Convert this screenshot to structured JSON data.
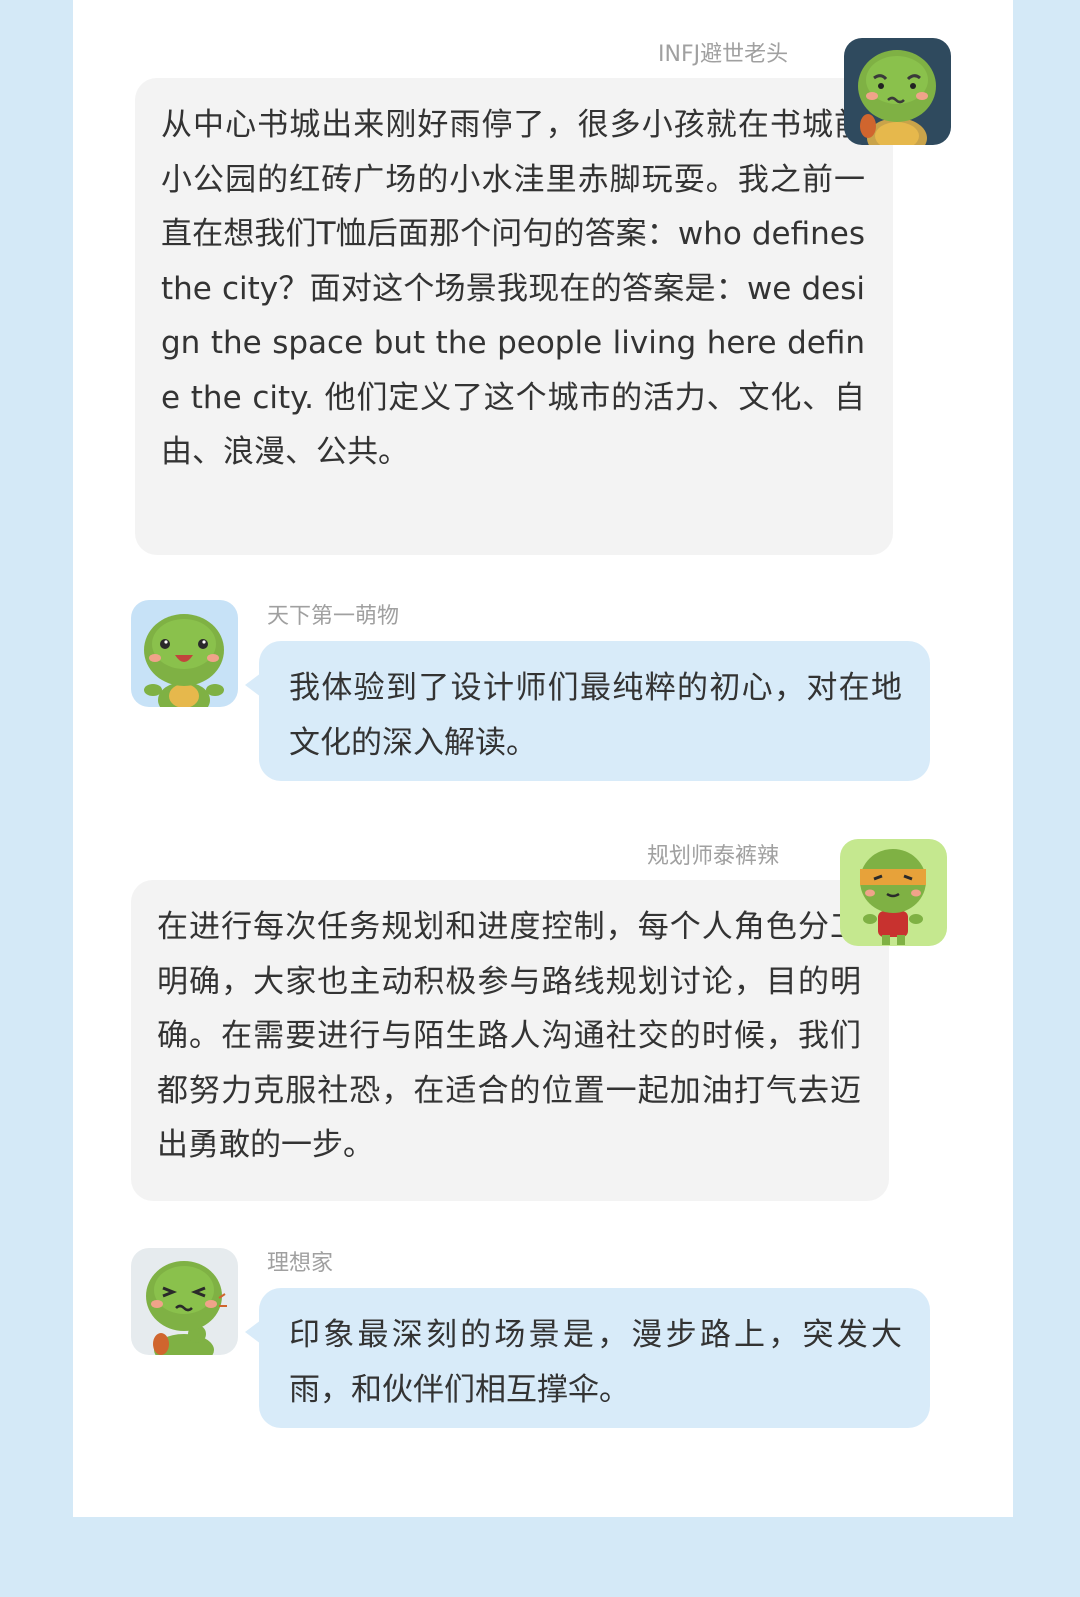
{
  "messages": [
    {
      "sender": "INFJ避世老头",
      "side": "right",
      "text": "从中心书城出来刚好雨停了，很多小孩就在书城前小公园的红砖广场的小水洼里赤脚玩耍。我之前一直在想我们T恤后面那个问句的答案：who defines the city？面对这个场景我现在的答案是：we design the space but the people living here define the city. 他们定义了这个城市的活力、文化、自由、浪漫、公共。",
      "avatar_icon": "turtle-worried-avatar-icon"
    },
    {
      "sender": "天下第一萌物",
      "side": "left",
      "text": "我体验到了设计师们最纯粹的初心，对在地文化的深入解读。",
      "avatar_icon": "turtle-smiling-avatar-icon"
    },
    {
      "sender": "规划师泰裤辣",
      "side": "right",
      "text": "在进行每次任务规划和进度控制，每个人角色分工明确，大家也主动积极参与路线规划讨论，目的明确。在需要进行与陌生路人沟通社交的时候，我们都努力克服社恐，在适合的位置一起加油打气去迈出勇敢的一步。",
      "avatar_icon": "turtle-ninja-avatar-icon"
    },
    {
      "sender": "理想家",
      "side": "left",
      "text": "印象最深刻的场景是，漫步路上，突发大雨，和伙伴们相互撑伞。",
      "avatar_icon": "turtle-grumpy-avatar-icon"
    }
  ],
  "colors": {
    "frame_bg": "#d4e9f7",
    "card_bg": "#ffffff",
    "bubble_gray": "#f3f3f3",
    "bubble_blue": "#d8ebf9",
    "turtle_green": "#7fb144",
    "name_text": "#a0a0a0"
  }
}
